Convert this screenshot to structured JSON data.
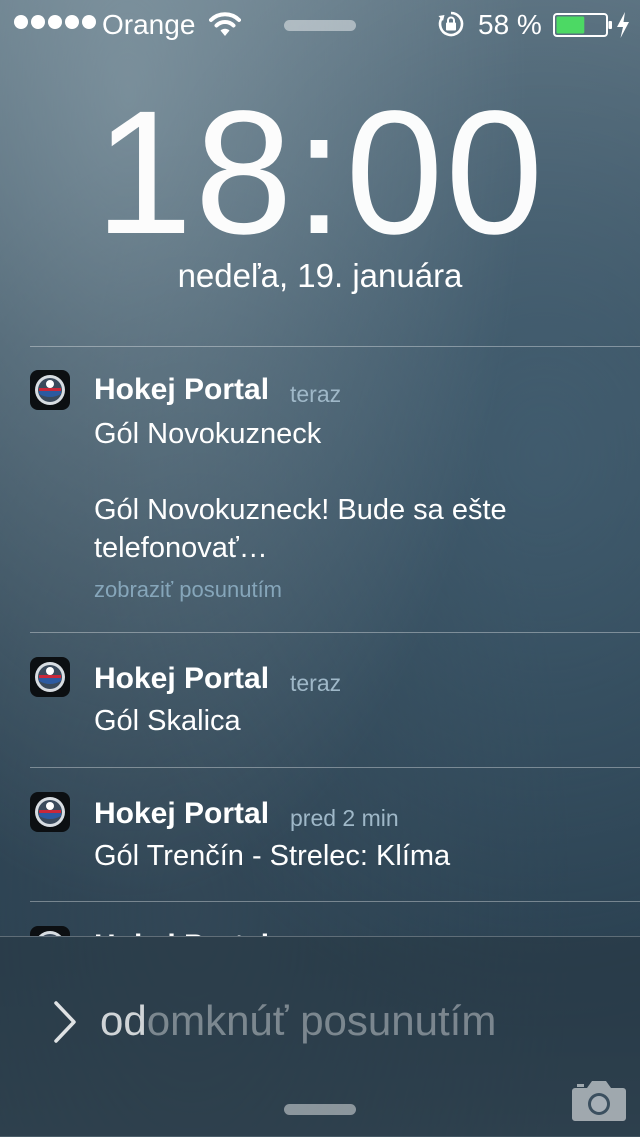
{
  "status_bar": {
    "signal_bars": 5,
    "carrier": "Orange",
    "battery_percent": "58 %",
    "battery_level": 0.58,
    "battery_color": "#4cd964",
    "charging": true,
    "icons": [
      "wifi-icon",
      "rotation-lock-icon",
      "battery-icon",
      "charging-icon"
    ]
  },
  "lock_screen": {
    "time_hours": "18",
    "time_separator": ":",
    "time_minutes": "00",
    "date": "nedeľa, 19. januára"
  },
  "notifications": [
    {
      "app": "Hokej Portal",
      "time": "teraz",
      "title": "Gól Novokuzneck",
      "message_line1": "Gól Novokuzneck! Bude sa ešte",
      "message_line2": "telefonovať…",
      "hint": "zobraziť posunutím"
    },
    {
      "app": "Hokej Portal",
      "time": "teraz",
      "title": "Gól Skalica"
    },
    {
      "app": "Hokej Portal",
      "time": "pred 2 min",
      "title": "Gól Trenčín - Strelec: Klíma"
    },
    {
      "app": "Hokej Portal"
    }
  ],
  "unlock": {
    "label_highlight": "od",
    "label_rest": "omknúť posunutím"
  },
  "colors": {
    "accent_text": "#9fb8c8",
    "hint_text": "#86a6ba"
  }
}
